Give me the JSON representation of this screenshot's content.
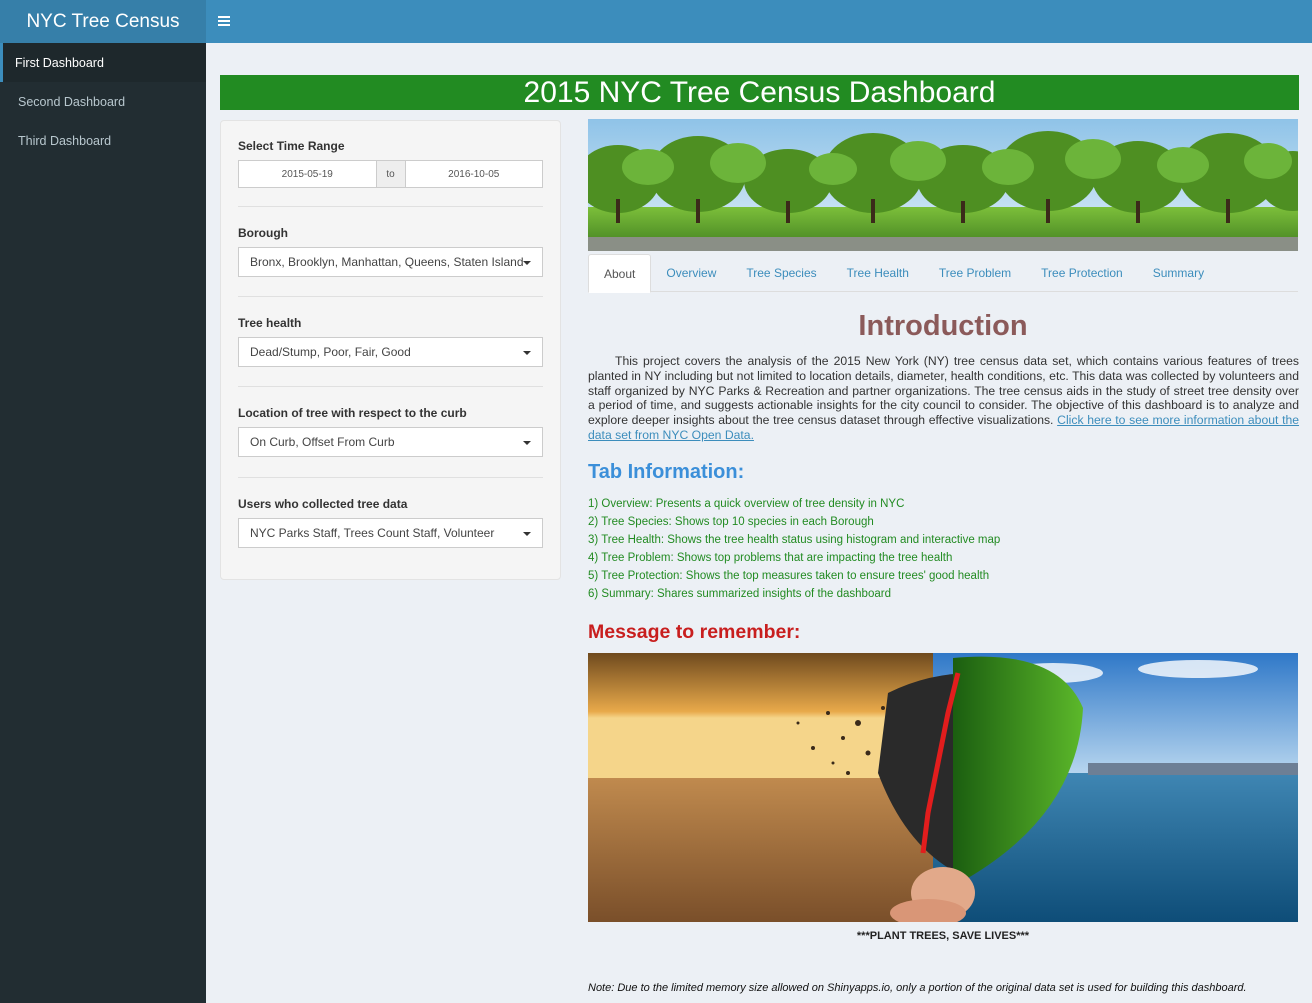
{
  "header": {
    "logo": "NYC Tree Census",
    "menu_icon": "hamburger-icon"
  },
  "sidebar": {
    "items": [
      {
        "label": "First Dashboard",
        "active": true
      },
      {
        "label": "Second Dashboard",
        "active": false
      },
      {
        "label": "Third Dashboard",
        "active": false
      }
    ]
  },
  "main": {
    "title": "2015 NYC Tree Census Dashboard"
  },
  "filters": {
    "time_range": {
      "label": "Select Time Range",
      "start": "2015-05-19",
      "separator": "to",
      "end": "2016-10-05"
    },
    "borough": {
      "label": "Borough",
      "value": "Bronx, Brooklyn, Manhattan, Queens, Staten Island"
    },
    "tree_health": {
      "label": "Tree health",
      "value": "Dead/Stump, Poor, Fair, Good"
    },
    "curb_location": {
      "label": "Location of tree with respect to the curb",
      "value": "On Curb, Offset From Curb"
    },
    "users": {
      "label": "Users who collected tree data",
      "value": "NYC Parks Staff, Trees Count Staff, Volunteer"
    }
  },
  "tabs": [
    "About",
    "Overview",
    "Tree Species",
    "Tree Health",
    "Tree Problem",
    "Tree Protection",
    "Summary"
  ],
  "about": {
    "intro_heading": "Introduction",
    "intro_text": "This project covers the analysis of the 2015 New York (NY) tree census data set, which contains various features of trees planted in NY including but not limited to location details, diameter, health conditions, etc. This data was collected by volunteers and staff organized by NYC Parks & Recreation and partner organizations. The tree census aids in the study of street tree density over a period of time, and suggests actionable insights for the city council to consider. The objective of this dashboard is to analyze and explore deeper insights about the tree census dataset through effective visualizations.",
    "intro_link": "Click here to see more information about the data set from NYC Open Data.",
    "tab_info_heading": "Tab Information:",
    "tab_info": [
      "1) Overview: Presents a quick overview of tree density in NYC",
      "2) Tree Species: Shows top 10 species in each Borough",
      "3) Tree Health: Shows the tree health status using histogram and interactive map",
      "4) Tree Problem: Shows top problems that are impacting the tree health",
      "5) Tree Protection: Shows the top measures taken to ensure trees' good health",
      "6) Summary: Shares summarized insights of the dashboard"
    ],
    "message_heading": "Message to remember:",
    "plant_text": "***PLANT TREES, SAVE LIVES***",
    "note": "Note: Due to the limited memory size allowed on Shinyapps.io, only a portion of the original data set is used for building this dashboard."
  },
  "colors": {
    "header": "#3c8dbc",
    "logo_bg": "#367fa9",
    "sidebar": "#222d32",
    "title_bar": "#228b22",
    "intro_heading": "#8b5a5a",
    "tab_info_heading": "#3b8fd9",
    "tab_info_text": "#228b22",
    "message_heading": "#c81e1e"
  }
}
